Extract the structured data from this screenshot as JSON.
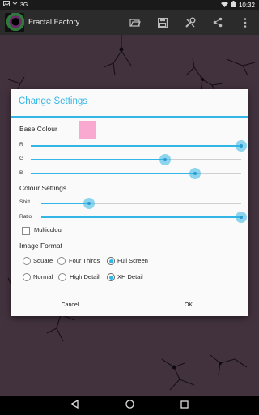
{
  "status_bar": {
    "signal_text": "3G",
    "time": "10:32",
    "left_icons": [
      "photo-icon",
      "download-icon"
    ],
    "right_icons": [
      "wifi-icon",
      "battery-icon"
    ]
  },
  "action_bar": {
    "title": "Fractal Factory",
    "actions": [
      "open-folder-icon",
      "save-icon",
      "settings-icon",
      "share-icon",
      "overflow-menu-icon"
    ]
  },
  "dialog": {
    "title": "Change Settings",
    "base_colour": {
      "heading": "Base Colour",
      "swatch_color": "#f9a9cf",
      "sliders": [
        {
          "label": "R",
          "value": 1.0
        },
        {
          "label": "G",
          "value": 0.64
        },
        {
          "label": "B",
          "value": 0.78
        }
      ]
    },
    "colour_settings": {
      "heading": "Colour Settings",
      "sliders": [
        {
          "label": "Shift",
          "value": 0.24
        },
        {
          "label": "Ratio",
          "value": 1.0
        }
      ],
      "multicolour": {
        "label": "Multicolour",
        "checked": false
      }
    },
    "image_format": {
      "heading": "Image Format",
      "size_options": [
        {
          "label": "Square",
          "selected": false
        },
        {
          "label": "Four Thirds",
          "selected": false
        },
        {
          "label": "Full Screen",
          "selected": true
        }
      ],
      "detail_options": [
        {
          "label": "Normal",
          "selected": false
        },
        {
          "label": "High Detail",
          "selected": false
        },
        {
          "label": "XH Detail",
          "selected": true
        }
      ]
    },
    "buttons": {
      "cancel": "Cancel",
      "ok": "OK"
    }
  },
  "colors": {
    "accent": "#33b5e5",
    "fractal_background": "#6e5466"
  }
}
